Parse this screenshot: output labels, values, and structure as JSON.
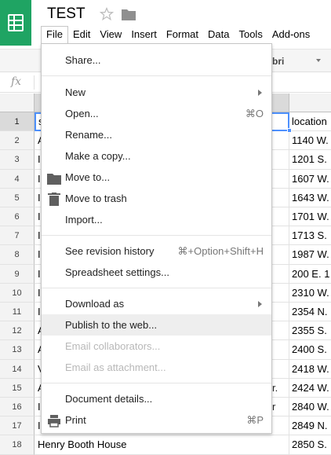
{
  "document": {
    "title": "TEST"
  },
  "menubar": [
    "File",
    "Edit",
    "View",
    "Insert",
    "Format",
    "Data",
    "Tools",
    "Add-ons"
  ],
  "toolbar": {
    "font": "bri"
  },
  "formula": {
    "fx_label": "fx"
  },
  "grid": {
    "rows": [
      {
        "num": "1",
        "a": "s",
        "b": "location"
      },
      {
        "num": "2",
        "a": "A",
        "b": "1140 W."
      },
      {
        "num": "3",
        "a": "I",
        "b": "1201 S."
      },
      {
        "num": "4",
        "a": "I",
        "b": "1607 W."
      },
      {
        "num": "5",
        "a": "I",
        "b": "1643 W."
      },
      {
        "num": "6",
        "a": "I",
        "b": "1701 W."
      },
      {
        "num": "7",
        "a": "I",
        "b": "1713 S."
      },
      {
        "num": "8",
        "a": "I",
        "b": "1987 W."
      },
      {
        "num": "9",
        "a": "I",
        "b": "200 E. 1"
      },
      {
        "num": "10",
        "a": "I",
        "b": "2310 W."
      },
      {
        "num": "11",
        "a": "I",
        "b": "2354 N."
      },
      {
        "num": "12",
        "a": "A",
        "b": "2355 S."
      },
      {
        "num": "13",
        "a": "A",
        "b": "2400 S."
      },
      {
        "num": "14",
        "a": "V",
        "b": "2418 W."
      },
      {
        "num": "15",
        "a": "A",
        "b": "2424 W."
      },
      {
        "num": "16",
        "a": "I",
        "b": "2840 W."
      },
      {
        "num": "17",
        "a": "I",
        "b": "2849 N."
      },
      {
        "num": "18",
        "a": "Henry Booth House",
        "b": "2850 S."
      }
    ],
    "overflow": {
      "r15": "r.",
      "r16": "r"
    }
  },
  "file_menu": {
    "share": "Share...",
    "new": "New",
    "open": "Open...",
    "open_sc": "⌘O",
    "rename": "Rename...",
    "copy": "Make a copy...",
    "move": "Move to...",
    "trash": "Move to trash",
    "import": "Import...",
    "revision": "See revision history",
    "revision_sc": "⌘+Option+Shift+H",
    "settings": "Spreadsheet settings...",
    "download": "Download as",
    "publish": "Publish to the web...",
    "email_collab": "Email collaborators...",
    "email_attach": "Email as attachment...",
    "details": "Document details...",
    "print": "Print",
    "print_sc": "⌘P"
  },
  "colors": {
    "brand": "#1fa463",
    "selection": "#4d90fe"
  }
}
